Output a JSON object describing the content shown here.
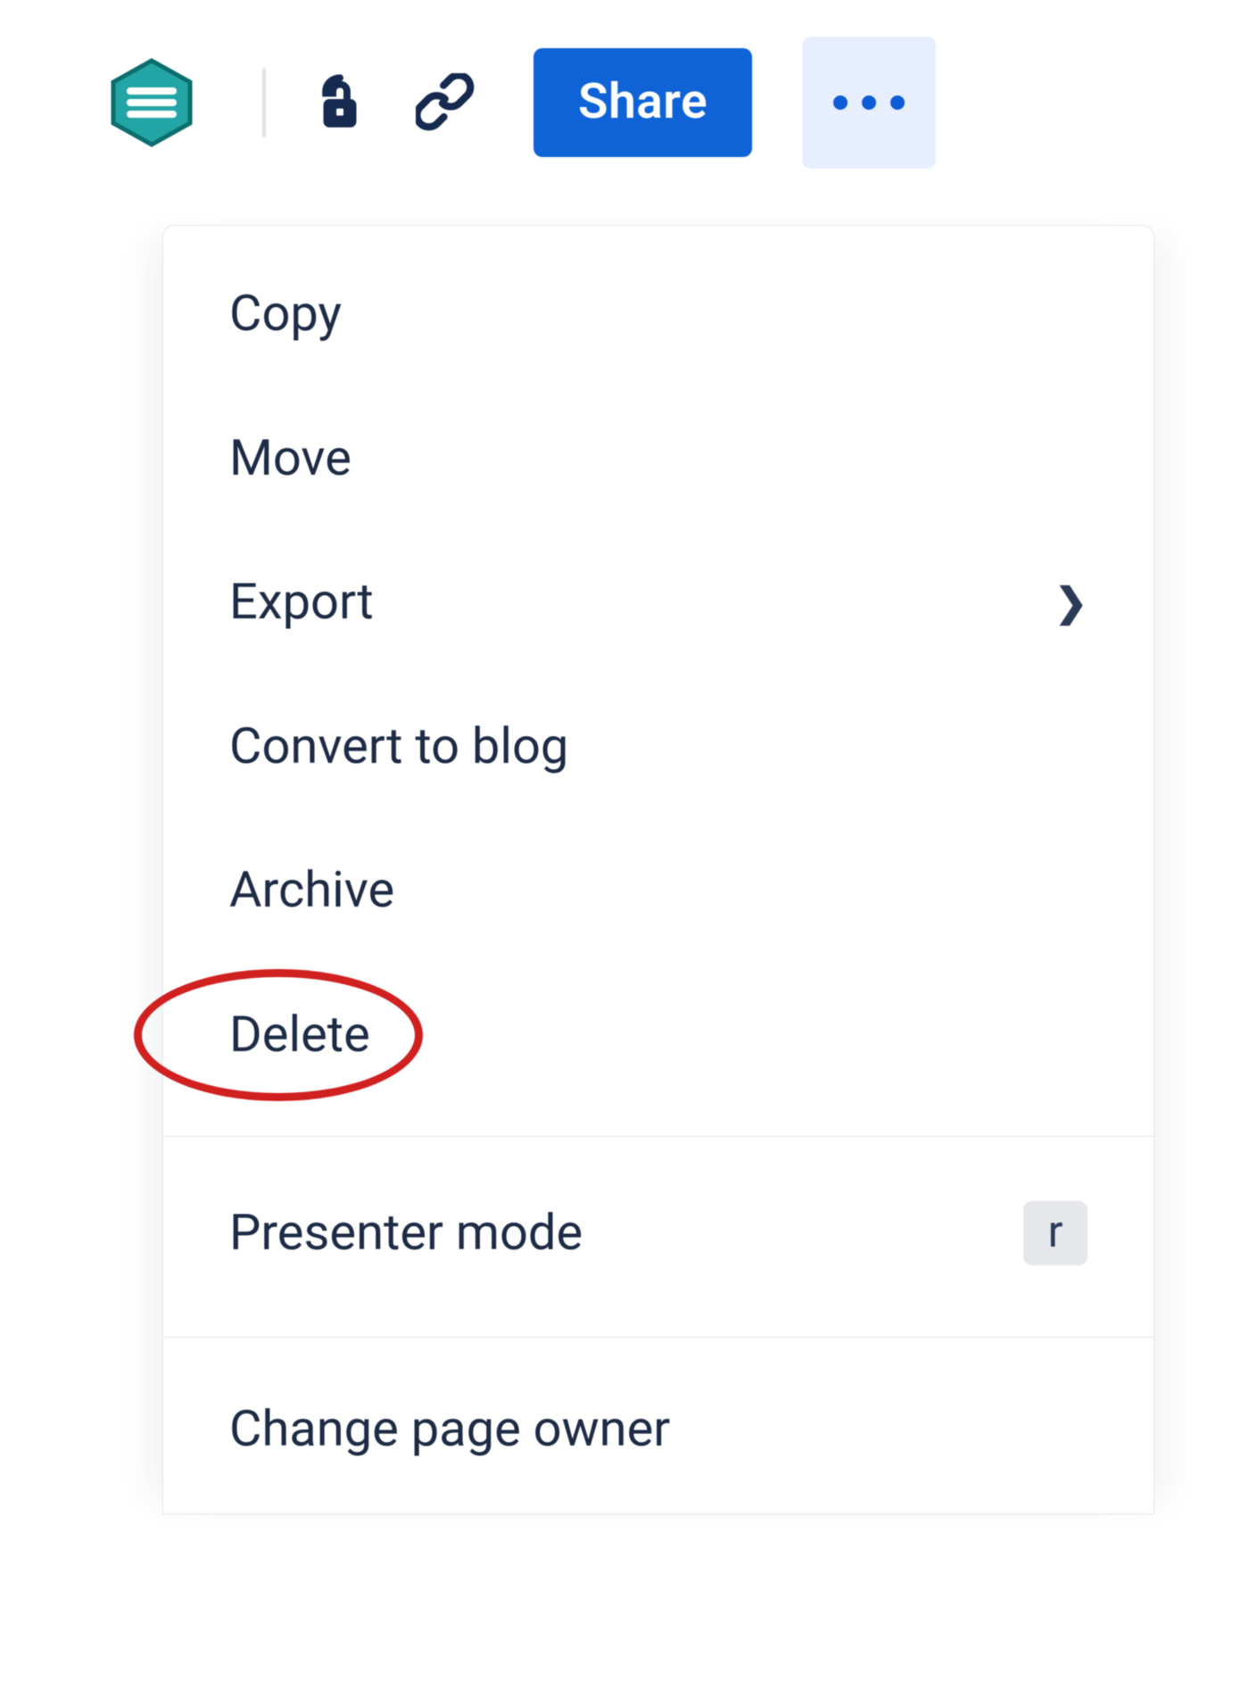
{
  "toolbar": {
    "logo_name": "app-logo",
    "lock_icon_name": "unlock-icon",
    "link_icon_name": "link-icon",
    "share_label": "Share",
    "more_icon_name": "more-icon",
    "colors": {
      "share_bg": "#0f63d6",
      "more_bg": "#e7efff",
      "logo_teal": "#24a5a5"
    }
  },
  "menu": {
    "sections": [
      {
        "items": [
          {
            "label": "Copy",
            "has_submenu": false
          },
          {
            "label": "Move",
            "has_submenu": false
          },
          {
            "label": "Export",
            "has_submenu": true
          },
          {
            "label": "Convert to blog",
            "has_submenu": false
          },
          {
            "label": "Archive",
            "has_submenu": false
          },
          {
            "label": "Delete",
            "has_submenu": false,
            "highlighted": true
          }
        ]
      },
      {
        "items": [
          {
            "label": "Presenter mode",
            "has_submenu": false,
            "shortcut": "r"
          }
        ]
      },
      {
        "items": [
          {
            "label": "Change page owner",
            "has_submenu": false
          }
        ]
      }
    ]
  }
}
